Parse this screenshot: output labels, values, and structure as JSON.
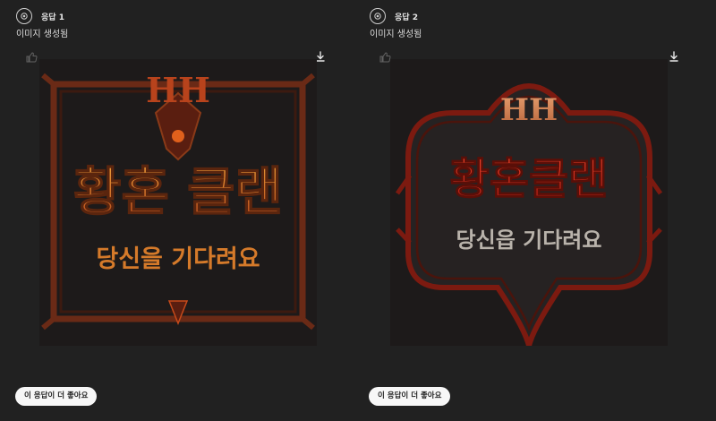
{
  "responses": [
    {
      "label": "응답 1",
      "status": "이미지 생성됨",
      "prefer_label": "이 응답이 더 좋아요",
      "image": {
        "brand": "HH",
        "title": "황혼 클랜",
        "tagline": "당신을 기다려요"
      }
    },
    {
      "label": "응답 2",
      "status": "이미지 생성됨",
      "prefer_label": "이 응답이 더 좋아요",
      "image": {
        "brand": "HH",
        "title": "황혼클랜",
        "tagline": "당신읍 기다려요"
      }
    }
  ],
  "icons": {
    "logo": "openai-logo-icon",
    "thumb": "thumbs-up-icon",
    "download": "download-icon"
  },
  "colors": {
    "background": "#212121",
    "orange": "#e07a1e",
    "red": "#d8341f"
  }
}
